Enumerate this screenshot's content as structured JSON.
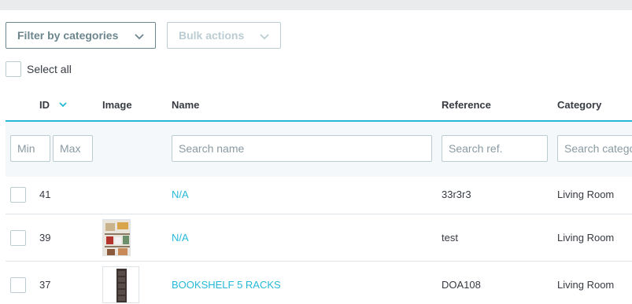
{
  "toolbar": {
    "filter_categories_label": "Filter by categories",
    "bulk_actions_label": "Bulk actions",
    "select_all_label": "Select all"
  },
  "table": {
    "columns": [
      "ID",
      "Image",
      "Name",
      "Reference",
      "Category"
    ],
    "sort_column": "ID",
    "filters": {
      "id_min_placeholder": "Min",
      "id_max_placeholder": "Max",
      "name_placeholder": "Search name",
      "reference_placeholder": "Search ref.",
      "category_placeholder": "Search category"
    },
    "rows": [
      {
        "id": "41",
        "name": "N/A",
        "reference": "33r3r3",
        "category": "Living Room",
        "image": "none"
      },
      {
        "id": "39",
        "name": "N/A",
        "reference": "test",
        "category": "Living Room",
        "image": "product-photo"
      },
      {
        "id": "37",
        "name": "BOOKSHELF 5 RACKS",
        "reference": "DOA108",
        "category": "Living Room",
        "image": "bookshelf-photo"
      }
    ]
  },
  "colors": {
    "accent": "#25b9d7",
    "text": "#363a41",
    "muted": "#6c868e",
    "border": "#bbcdd2"
  }
}
